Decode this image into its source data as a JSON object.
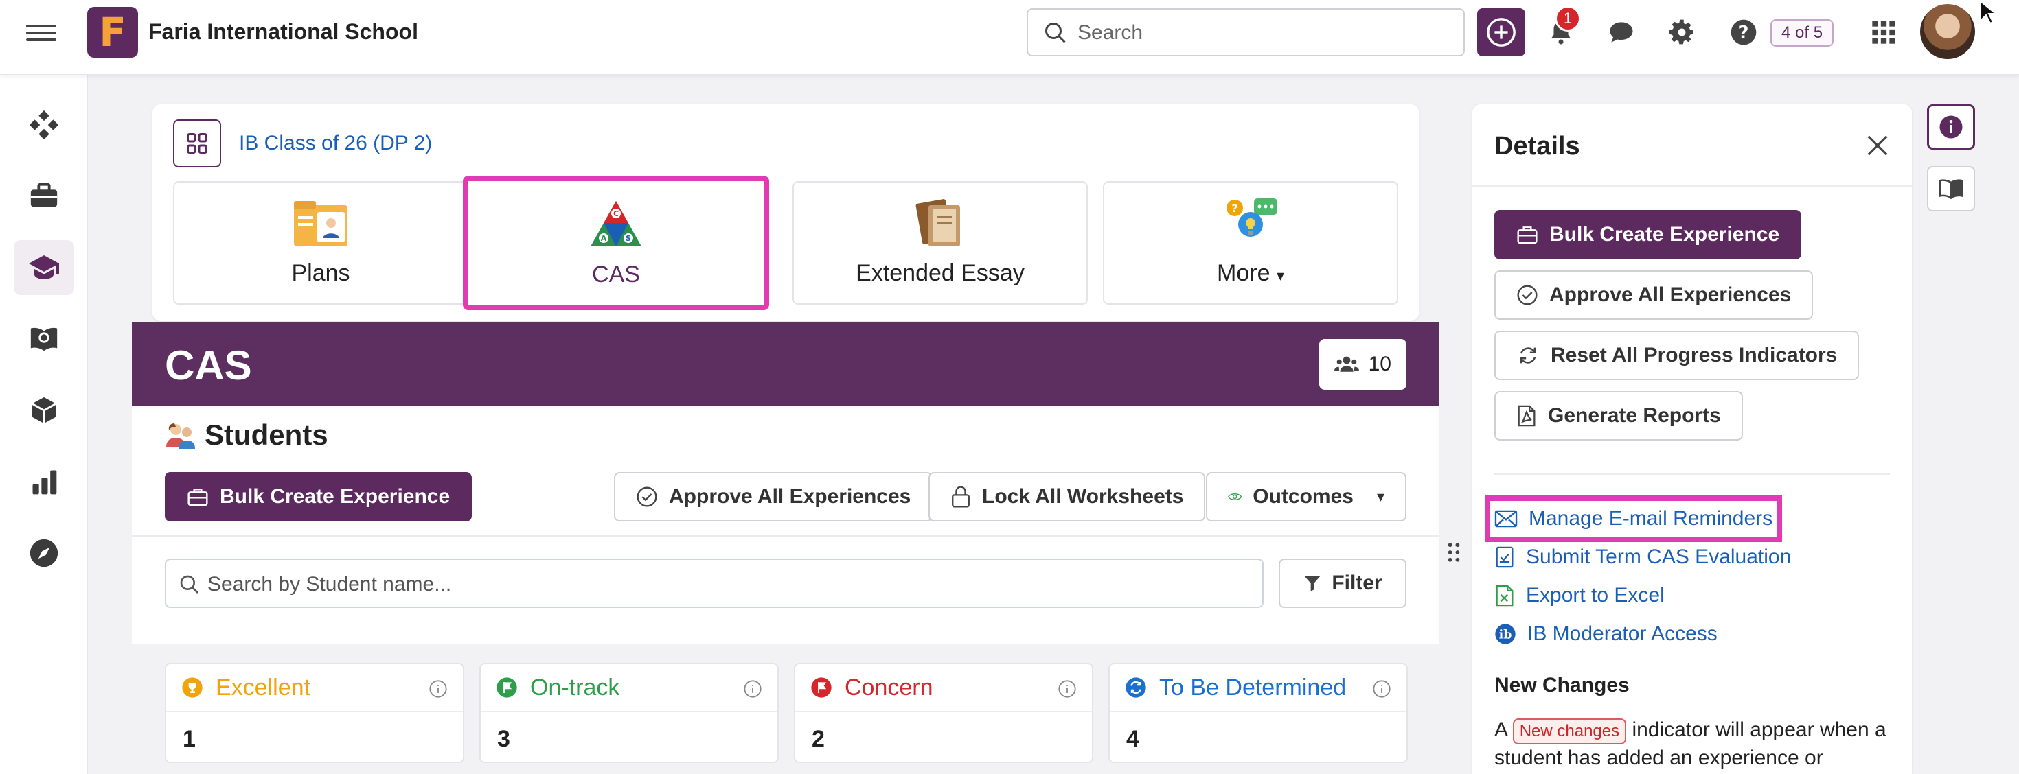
{
  "topbar": {
    "logo_letter": "F",
    "school_name": "Faria International School",
    "search_placeholder": "Search",
    "notification_count": "1",
    "page_counter": "4 of 5"
  },
  "nav": {
    "class_link": "IB Class of 26 (DP 2)",
    "tiles": [
      {
        "label": "Plans"
      },
      {
        "label": "CAS"
      },
      {
        "label": "Extended Essay"
      },
      {
        "label": "More"
      }
    ]
  },
  "cas": {
    "title": "CAS",
    "student_count": "10",
    "students_title": "Students",
    "actions": {
      "bulk_create": "Bulk Create Experience",
      "approve_all": "Approve All Experiences",
      "lock_all": "Lock All Worksheets",
      "outcomes": "Outcomes"
    },
    "search_placeholder": "Search by Student name...",
    "filter_label": "Filter",
    "status_cards": [
      {
        "label": "Excellent",
        "value": "1",
        "color": "#f0a30a"
      },
      {
        "label": "On-track",
        "value": "3",
        "color": "#2e9e4a"
      },
      {
        "label": "Concern",
        "value": "2",
        "color": "#d6262b"
      },
      {
        "label": "To Be Determined",
        "value": "4",
        "color": "#1a6fd1"
      }
    ]
  },
  "details": {
    "title": "Details",
    "buttons": {
      "bulk_create": "Bulk Create Experience",
      "approve_all": "Approve All Experiences",
      "reset_progress": "Reset All Progress Indicators",
      "generate_reports": "Generate Reports"
    },
    "links": {
      "manage_reminders": "Manage E-mail Reminders",
      "submit_evaluation": "Submit Term CAS Evaluation",
      "export_excel": "Export to Excel",
      "moderator_access": "IB Moderator Access"
    },
    "new_changes_title": "New Changes",
    "new_changes_prefix": "A",
    "new_changes_badge": "New changes",
    "new_changes_suffix": "indicator will appear when a student has added an experience or"
  },
  "colors": {
    "brand": "#5c2a5f",
    "highlight": "#e03ab4",
    "link": "#1a5fb4"
  }
}
